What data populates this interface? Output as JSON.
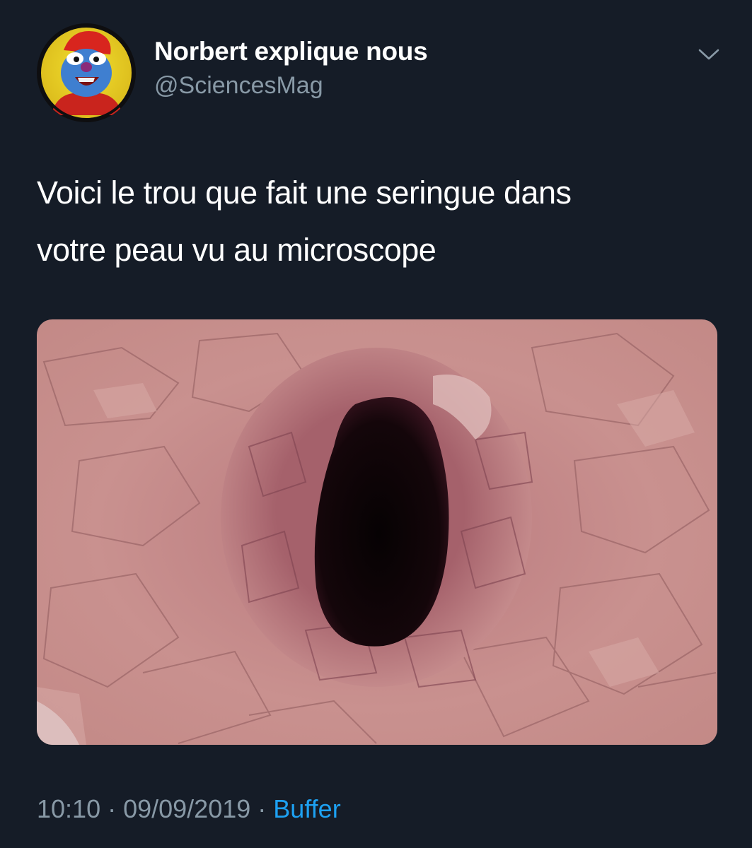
{
  "author": {
    "display_name": "Norbert explique nous",
    "handle": "@SciencesMag",
    "avatar_icon": "puppet-avatar"
  },
  "menu": {
    "icon": "chevron-down-icon"
  },
  "tweet": {
    "text_line_1": "Voici le trou que fait une seringue dans",
    "text_line_2": "votre peau vu au microscope",
    "media_description_icon": "microscope-skin-photo"
  },
  "meta": {
    "time": "10:10",
    "separator": "·",
    "date": "09/09/2019",
    "source": "Buffer"
  },
  "colors": {
    "background": "#151c27",
    "primary_text": "#ffffff",
    "secondary_text": "#8899a6",
    "link": "#1da1f2"
  }
}
